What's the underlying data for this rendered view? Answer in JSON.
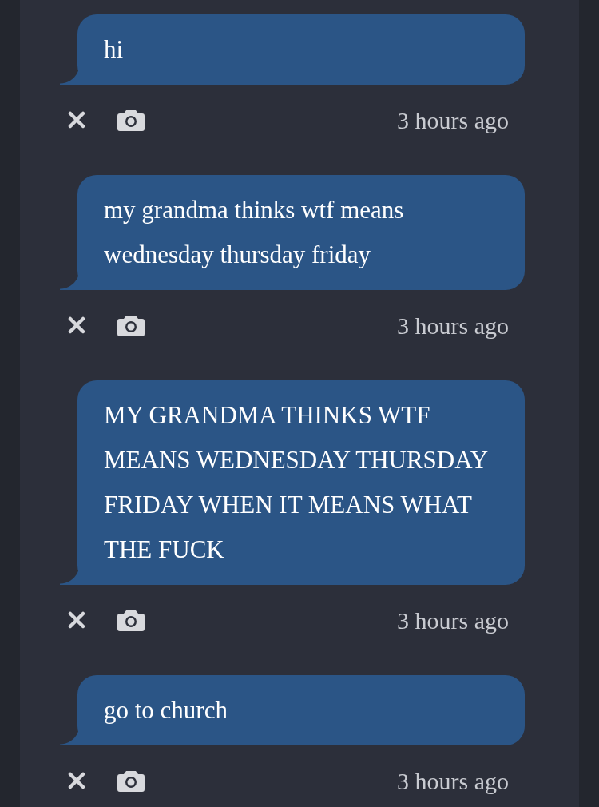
{
  "messages": [
    {
      "text": "hi",
      "time": "3 hours ago"
    },
    {
      "text": "my grandma thinks wtf means wednesday thursday friday",
      "time": "3 hours ago"
    },
    {
      "text": "MY GRANDMA THINKS WTF MEANS WEDNESDAY THURSDAY FRIDAY WHEN IT MEANS WHAT THE FUCK",
      "time": "3 hours ago"
    },
    {
      "text": "go to church",
      "time": "3 hours ago"
    }
  ]
}
